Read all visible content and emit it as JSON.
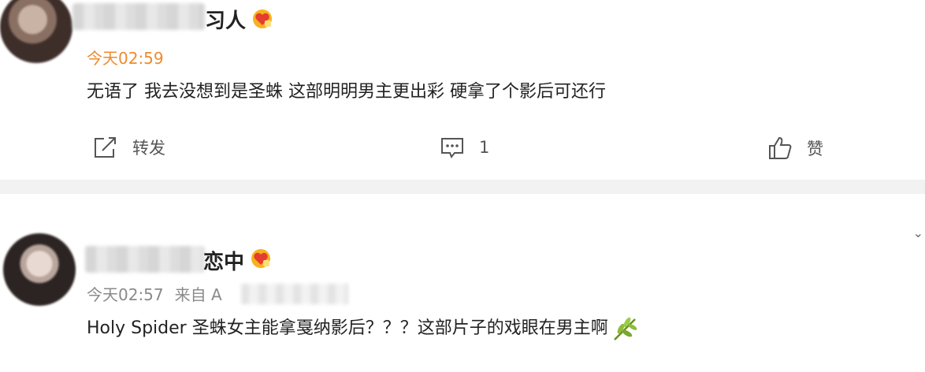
{
  "posts": [
    {
      "name_visible": "习人",
      "time": "今天02:59",
      "content": "无语了 我去没想到是圣蛛 这部明明男主更出彩 硬拿了个影后可还行",
      "actions": {
        "repost": "转发",
        "comment_count": "1",
        "like": "赞"
      }
    },
    {
      "name_visible": "恋中",
      "time": "今天02:57",
      "source_prefix": "来自 A",
      "content": "Holy Spider 圣蛛女主能拿戛纳影后？？？这部片子的戏眼在男主啊"
    }
  ],
  "icons": {
    "fan_badge": "heart-badge-icon",
    "repost": "share-icon",
    "comment": "comment-icon",
    "like": "thumbs-up-icon",
    "emoji": "leaf-icon",
    "collapse": "chevron-down-icon"
  },
  "colors": {
    "time": "#f08a2c",
    "meta": "#8a8a8a",
    "divider": "#f2f2f2"
  }
}
